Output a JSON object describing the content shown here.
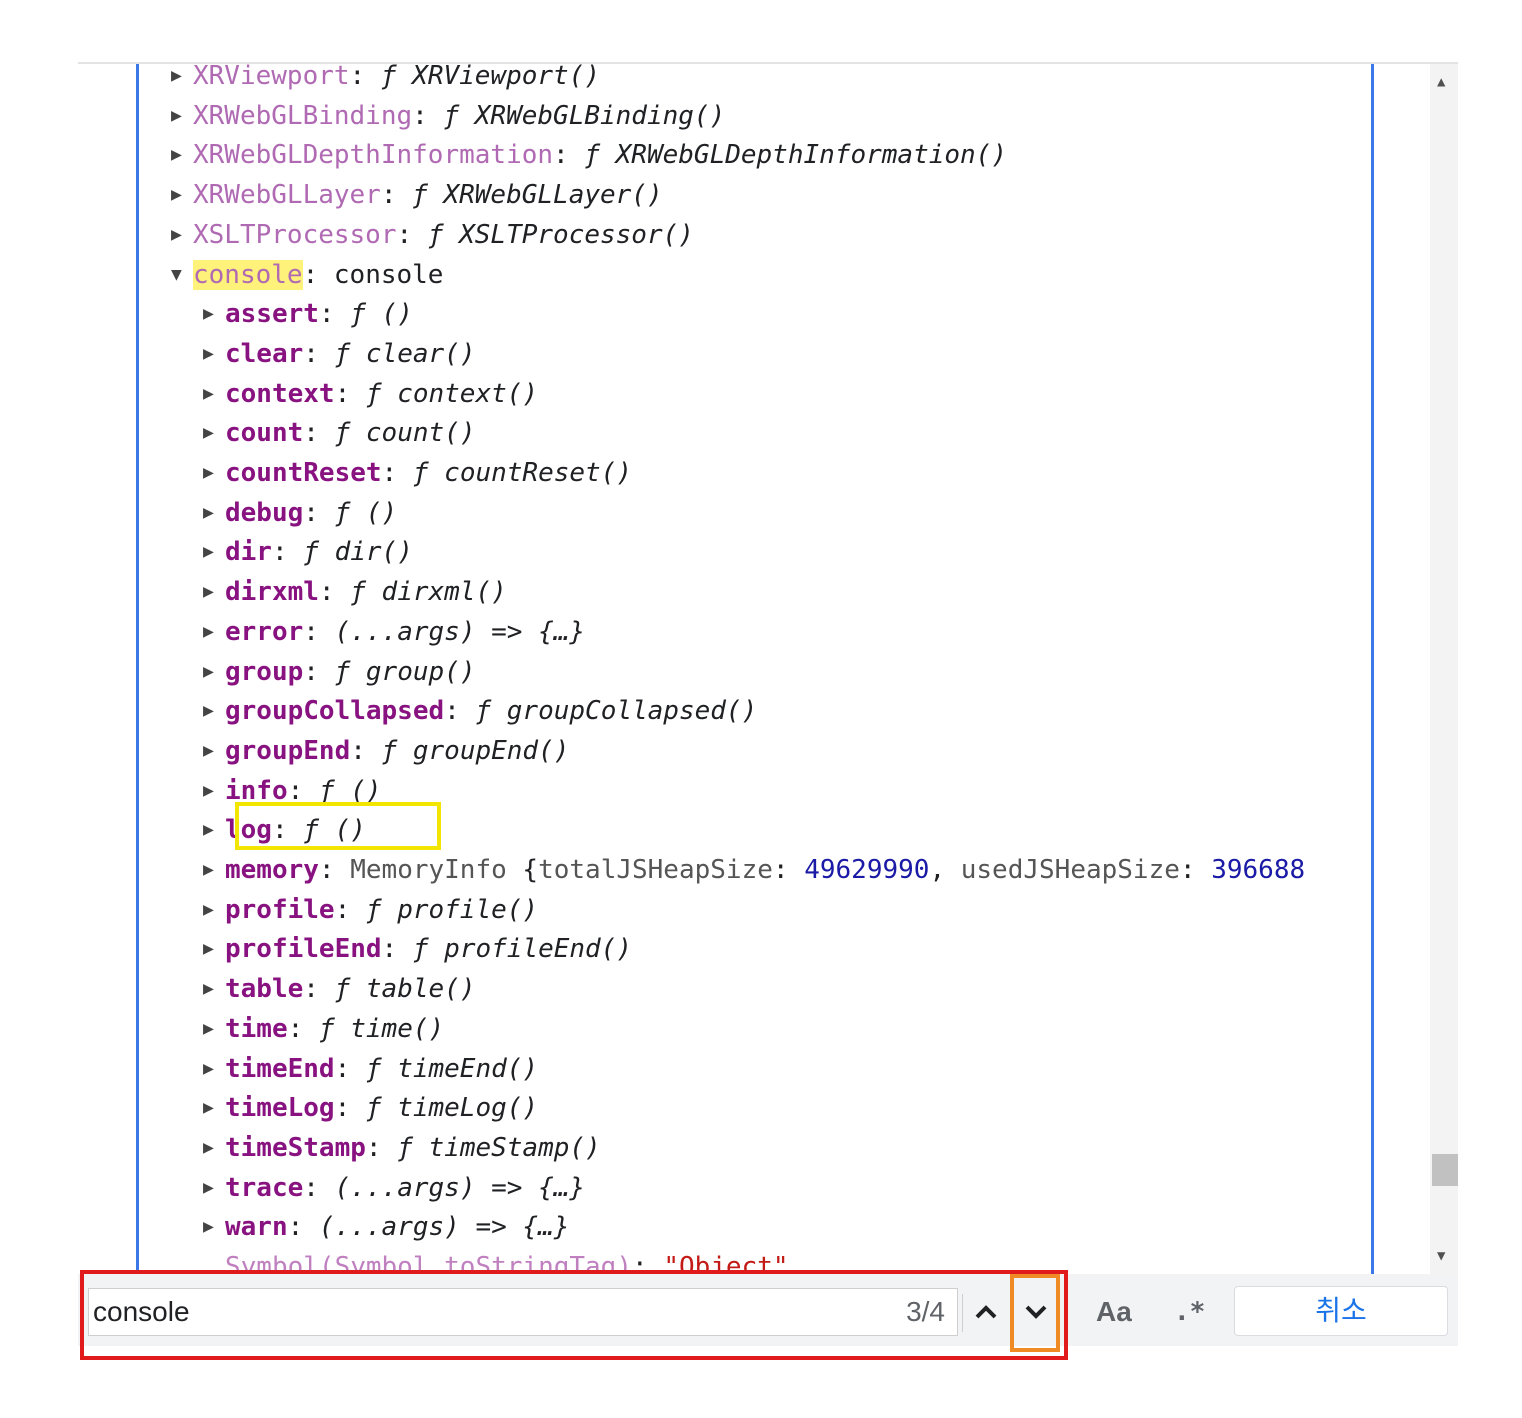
{
  "colors": {
    "accent_blue": "#3b78e7",
    "outer_key": "#b06ab3",
    "inner_key": "#881280",
    "highlight": "#fff27a",
    "number": "#1a1aa6",
    "string": "#c41a16",
    "annotation_red": "#e11b1b",
    "annotation_orange": "#f08a24",
    "annotation_yellow": "#f2e600"
  },
  "tree": {
    "outer": [
      {
        "key": "XRViewport",
        "value": "XRViewport()"
      },
      {
        "key": "XRWebGLBinding",
        "value": "XRWebGLBinding()"
      },
      {
        "key": "XRWebGLDepthInformation",
        "value": "XRWebGLDepthInformation()"
      },
      {
        "key": "XRWebGLLayer",
        "value": "XRWebGLLayer()"
      },
      {
        "key": "XSLTProcessor",
        "value": "XSLTProcessor()"
      }
    ],
    "expanded": {
      "key": "console",
      "value": "console"
    },
    "children": [
      {
        "key": "assert",
        "prefix": "ƒ ",
        "value": "()"
      },
      {
        "key": "clear",
        "prefix": "ƒ ",
        "value": "clear()"
      },
      {
        "key": "context",
        "prefix": "ƒ ",
        "value": "context()"
      },
      {
        "key": "count",
        "prefix": "ƒ ",
        "value": "count()"
      },
      {
        "key": "countReset",
        "prefix": "ƒ ",
        "value": "countReset()"
      },
      {
        "key": "debug",
        "prefix": "ƒ ",
        "value": "()"
      },
      {
        "key": "dir",
        "prefix": "ƒ ",
        "value": "dir()"
      },
      {
        "key": "dirxml",
        "prefix": "ƒ ",
        "value": "dirxml()"
      },
      {
        "key": "error",
        "prefix": "",
        "value": "(...args) => {…}"
      },
      {
        "key": "group",
        "prefix": "ƒ ",
        "value": "group()"
      },
      {
        "key": "groupCollapsed",
        "prefix": "ƒ ",
        "value": "groupCollapsed()"
      },
      {
        "key": "groupEnd",
        "prefix": "ƒ ",
        "value": "groupEnd()"
      },
      {
        "key": "info",
        "prefix": "ƒ ",
        "value": "()"
      },
      {
        "key": "log",
        "prefix": "ƒ ",
        "value": "()"
      },
      {
        "key": "memory",
        "special": "memory"
      },
      {
        "key": "profile",
        "prefix": "ƒ ",
        "value": "profile()"
      },
      {
        "key": "profileEnd",
        "prefix": "ƒ ",
        "value": "profileEnd()"
      },
      {
        "key": "table",
        "prefix": "ƒ ",
        "value": "table()"
      },
      {
        "key": "time",
        "prefix": "ƒ ",
        "value": "time()"
      },
      {
        "key": "timeEnd",
        "prefix": "ƒ ",
        "value": "timeEnd()"
      },
      {
        "key": "timeLog",
        "prefix": "ƒ ",
        "value": "timeLog()"
      },
      {
        "key": "timeStamp",
        "prefix": "ƒ ",
        "value": "timeStamp()"
      },
      {
        "key": "trace",
        "prefix": "",
        "value": "(...args) => {…}"
      },
      {
        "key": "warn",
        "prefix": "",
        "value": "(...args) => {…}"
      }
    ],
    "memory": {
      "type": "MemoryInfo",
      "open": "{",
      "k1": "totalJSHeapSize",
      "v1": "49629990",
      "k2": "usedJSHeapSize",
      "v2": "396688"
    },
    "symbol_row": {
      "key": "Symbol(Symbol.toStringTag)",
      "value": "\"Object\""
    }
  },
  "search": {
    "value": "console",
    "match_count": "3/4",
    "case_label": "Aa",
    "regex_label": ".*",
    "cancel_label": "취소"
  },
  "icons": {
    "collapsed": "triangle-right-icon",
    "expanded": "triangle-down-icon",
    "prev": "chevron-up-icon",
    "next": "chevron-down-icon"
  }
}
